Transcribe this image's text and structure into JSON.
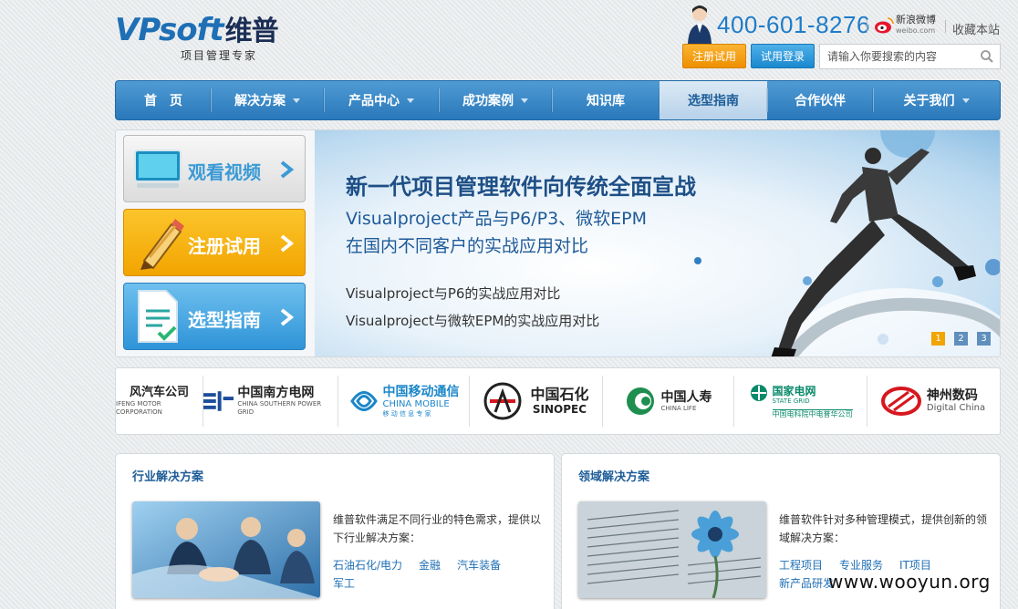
{
  "header": {
    "logo_en": "VPsoft",
    "logo_cn": "维普",
    "logo_tagline": "项目管理专家",
    "phone": "400-601-8276",
    "weibo_cn": "新浪微博",
    "weibo_en": "weibo.com",
    "favorite_label": "收藏本站",
    "register_label": "注册试用",
    "login_label": "试用登录",
    "search_placeholder": "请输入你要搜索的内容"
  },
  "nav": {
    "items": [
      {
        "label": "首　页"
      },
      {
        "label": "解决方案"
      },
      {
        "label": "产品中心"
      },
      {
        "label": "成功案例"
      },
      {
        "label": "知识库"
      },
      {
        "label": "选型指南"
      },
      {
        "label": "合作伙伴"
      },
      {
        "label": "关于我们"
      }
    ],
    "active_index": 5
  },
  "side_buttons": {
    "video": "观看视频",
    "register": "注册试用",
    "guide": "选型指南"
  },
  "slide": {
    "title": "新一代项目管理软件向传统全面宣战",
    "sub1": "Visualproject产品与P6/P3、微软EPM",
    "sub2": "在国内不同客户的实战应用对比",
    "line1": "Visualproject与P6的实战应用对比",
    "line2": "Visualproject与微软EPM的实战应用对比",
    "pages": [
      "1",
      "2",
      "3"
    ],
    "active_page": 1
  },
  "partners": [
    {
      "cn": "风汽车公司",
      "en": "IFENG MOTOR CORPORATION"
    },
    {
      "cn": "中国南方电网",
      "en": "CHINA SOUTHERN POWER GRID"
    },
    {
      "cn": "中国移动通信",
      "en": "CHINA MOBILE",
      "tag": "移 动 信 息 专 家"
    },
    {
      "cn": "中国石化",
      "en": "SINOPEC"
    },
    {
      "cn": "中国人寿",
      "en": "CHINA LIFE"
    },
    {
      "cn": "国家电网",
      "en": "STATE GRID",
      "tag": "中国电科院中电普华公司"
    },
    {
      "cn": "神州数码",
      "en": "Digital China"
    }
  ],
  "industry": {
    "title": "行业解决方案",
    "desc": "维普软件满足不同行业的特色需求，提供以下行业解决方案：",
    "links": [
      "石油石化/电力",
      "金融",
      "汽车装备",
      "军工"
    ]
  },
  "domain": {
    "title": "领域解决方案",
    "desc": "维普软件针对多种管理模式，提供创新的领域解决方案：",
    "links": [
      "工程项目",
      "专业服务",
      "IT项目",
      "新产品研发"
    ]
  },
  "watermark": "www.wooyun.org",
  "colors": {
    "brand_blue": "#1e6fb5",
    "nav_blue": "#2a78bb",
    "accent_orange": "#f2a400",
    "link_blue": "#1f6fb5"
  }
}
